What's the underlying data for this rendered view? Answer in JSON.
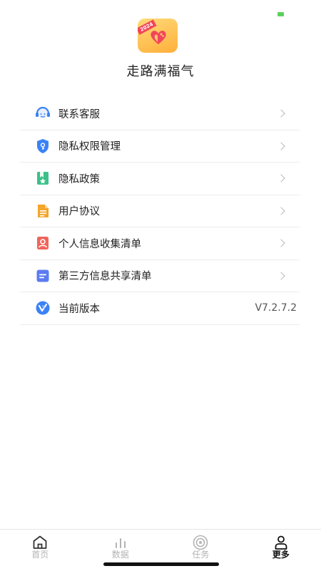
{
  "app": {
    "name": "走路满福气",
    "logo_badge": "2024"
  },
  "menu": {
    "items": [
      {
        "label": "联系客服",
        "icon": "customer-service-icon"
      },
      {
        "label": "隐私权限管理",
        "icon": "shield-icon"
      },
      {
        "label": "隐私政策",
        "icon": "bookmark-icon"
      },
      {
        "label": "用户协议",
        "icon": "document-icon"
      },
      {
        "label": "个人信息收集清单",
        "icon": "person-card-icon"
      },
      {
        "label": "第三方信息共享清单",
        "icon": "list-icon"
      },
      {
        "label": "当前版本",
        "icon": "version-icon",
        "value": "V7.2.7.2"
      }
    ]
  },
  "tabbar": {
    "tabs": [
      {
        "label": "首页",
        "icon": "home-icon",
        "active": false
      },
      {
        "label": "数据",
        "icon": "chart-icon",
        "active": false
      },
      {
        "label": "任务",
        "icon": "target-icon",
        "active": false
      },
      {
        "label": "更多",
        "icon": "person-icon",
        "active": true
      }
    ]
  },
  "colors": {
    "accent_blue": "#3b82f6",
    "battery_green": "#5cd05c",
    "logo_orange": "#ffb03a",
    "logo_red": "#f2455a"
  }
}
